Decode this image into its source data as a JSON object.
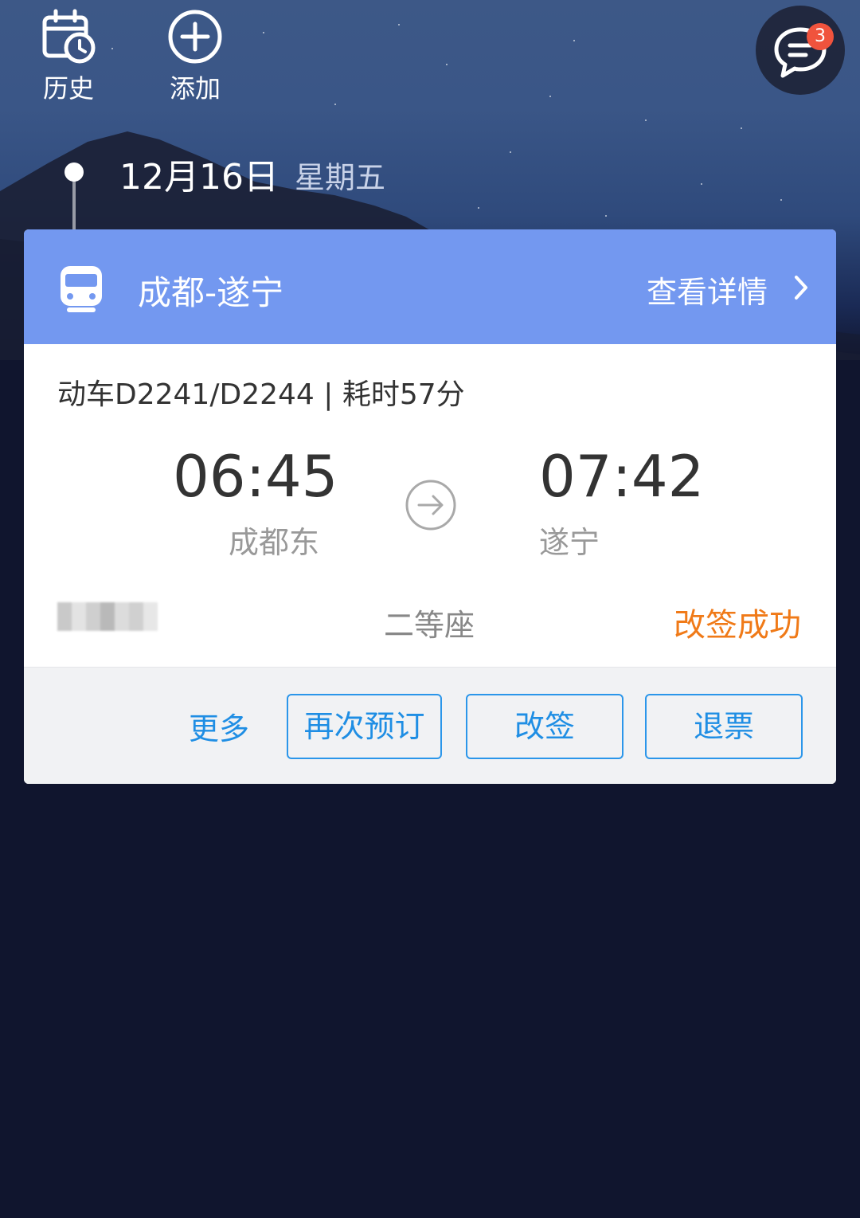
{
  "top_actions": {
    "history_label": "历史",
    "add_label": "添加"
  },
  "messages": {
    "badge_count": "3"
  },
  "timeline": {
    "date": "12月16日",
    "weekday": "星期五"
  },
  "trip_card": {
    "route": "成都-遂宁",
    "detail_link": "查看详情",
    "train_info": "动车D2241/D2244 | 耗时57分",
    "departure": {
      "time": "06:45",
      "station": "成都东"
    },
    "arrival": {
      "time": "07:42",
      "station": "遂宁"
    },
    "seat_class": "二等座",
    "status": "改签成功",
    "actions": {
      "more": "更多",
      "rebook": "再次预订",
      "change": "改签",
      "refund": "退票"
    }
  },
  "colors": {
    "card_header": "#7398f0",
    "status": "#f07a18",
    "action_blue": "#1f8ee4",
    "page_background": "#10152e",
    "badge": "#f0533d"
  },
  "icons": [
    "calendar-clock-icon",
    "plus-circle-icon",
    "chat-icon",
    "train-icon",
    "chevron-right-icon",
    "arrow-right-circle-icon"
  ]
}
